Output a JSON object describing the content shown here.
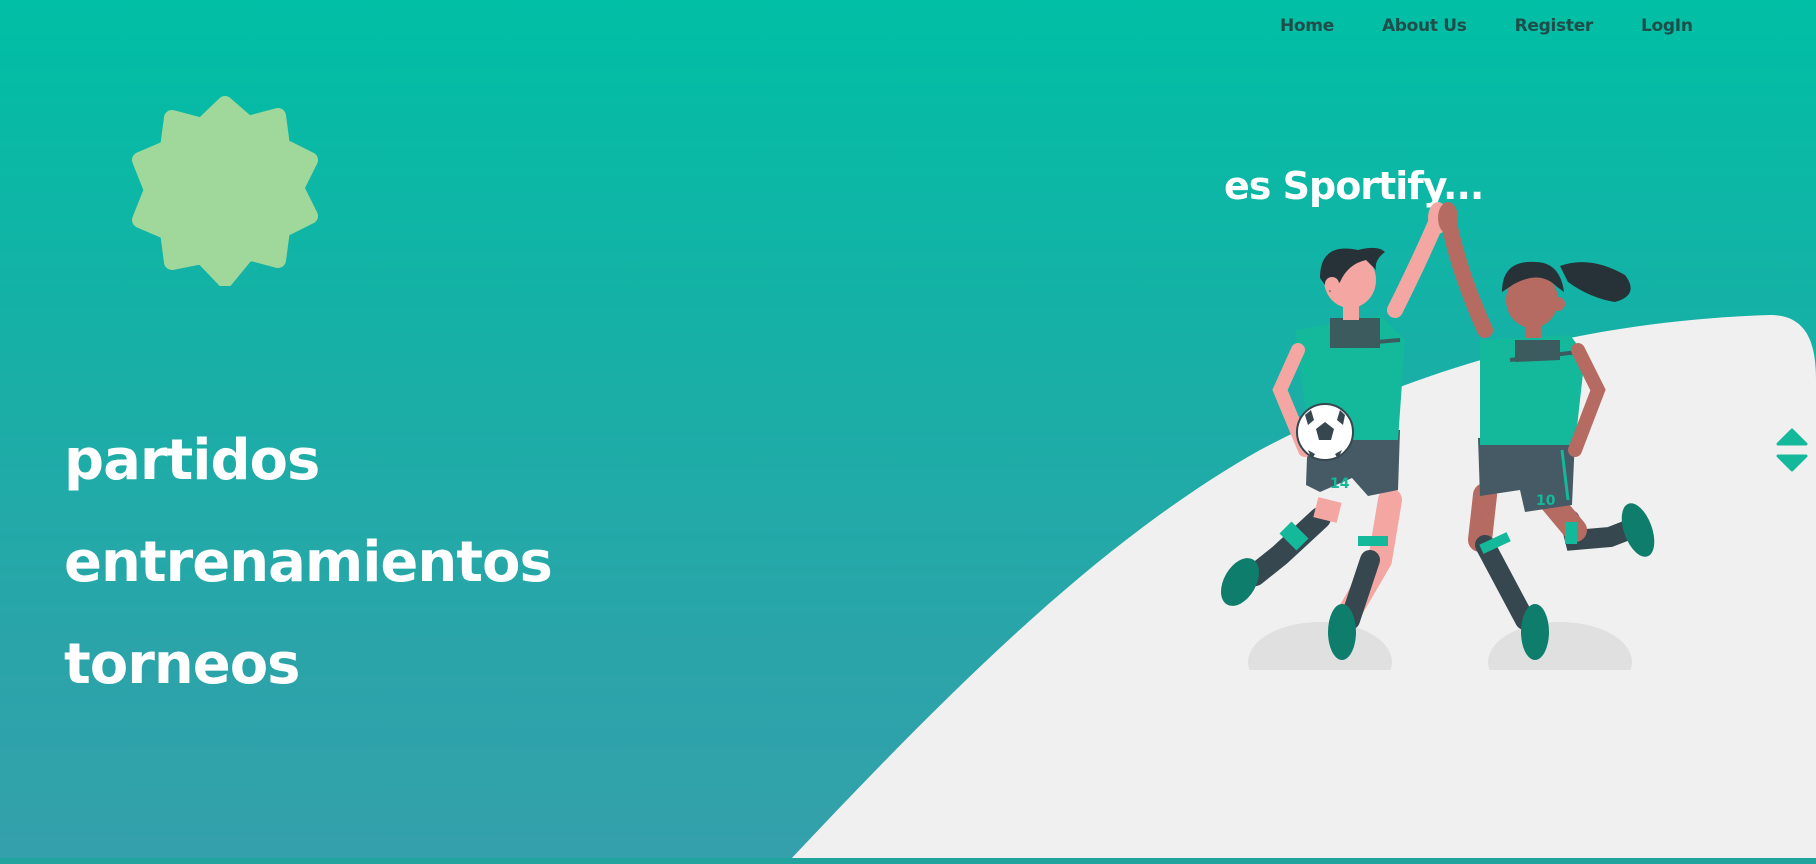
{
  "nav": {
    "items": [
      {
        "label": "Home"
      },
      {
        "label": "About Us"
      },
      {
        "label": "Register"
      },
      {
        "label": "LogIn"
      }
    ]
  },
  "hero": {
    "words": [
      "partidos",
      "entrenamientos",
      "torneos"
    ],
    "tagline": "es Sportify...",
    "jersey_numbers": [
      "14",
      "10"
    ]
  },
  "icons": {
    "badge": "scalloped-badge-icon",
    "scroll_up": "triangle-up-icon",
    "scroll_down": "triangle-down-icon",
    "ball": "soccer-ball-icon"
  },
  "colors": {
    "background_top": "#00bfa5",
    "background_bottom": "#34a0ab",
    "badge": "#a0d89b",
    "hill": "#f0f0f0",
    "jersey": "#14b89a",
    "shorts": "#455a64"
  }
}
